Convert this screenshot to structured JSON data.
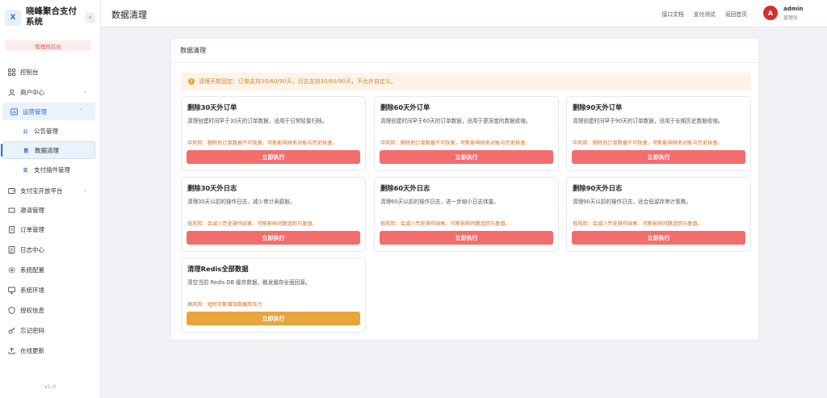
{
  "brand": {
    "logo": "X",
    "name": "晓峰聚合支付系统",
    "collapse_icon": "‹"
  },
  "admin_tag": "管理员后台",
  "menu": {
    "dashboard": "控制台",
    "merchant": "商户中心",
    "operations": "运营管理",
    "notice_mgmt": "公告管理",
    "data_clean": "数据清理",
    "plugin_mgmt": "支付插件管理",
    "alipay_open": "支付宝开放平台",
    "invite": "邀请管理",
    "orders": "订单管理",
    "logs": "日志中心",
    "config": "系统配置",
    "env": "系统环境",
    "license": "授权信息",
    "forgot_pwd": "忘记密码",
    "online_update": "在线更新",
    "sub_icons": {
      "notice": "公",
      "clean": "数",
      "plugin": "支"
    }
  },
  "version": "v1.0",
  "header": {
    "title": "数据清理",
    "links": [
      "接口文档",
      "支付测试",
      "返回首页"
    ],
    "avatar": "A",
    "user_name": "admin",
    "user_role": "管理员"
  },
  "panel": {
    "title": "数据清理",
    "notice": "清理天数固定：订单支持30/60/90天，日志支持30/60/90天，不允许自定义。",
    "notice_icon": "!"
  },
  "cards": [
    {
      "title": "删除30天外订单",
      "desc": "清理创建时间早于30天的订单数据，适用于日常轻量归档。",
      "risk": "中风险：删除后订单数据不可恢复，可能影响财务对账与历史核查。",
      "button": "立即执行"
    },
    {
      "title": "删除60天外订单",
      "desc": "清理创建时间早于60天的订单数据，适用于更深度的数据收缩。",
      "risk": "中风险：删除后订单数据不可恢复，可能影响财务对账与历史核查。",
      "button": "立即执行"
    },
    {
      "title": "删除90天外订单",
      "desc": "清理创建时间早于90天的订单数据，适用于长期历史数据收缩。",
      "risk": "中风险：删除后订单数据不可恢复，可能影响财务对账与历史核查。",
      "button": "立即执行"
    },
    {
      "title": "删除30天外日志",
      "desc": "清理30天以前的操作日志，减少审计表膨胀。",
      "risk": "低风险：会减少历史操作线索，可能影响问题追踪与复盘。",
      "button": "立即执行"
    },
    {
      "title": "删除60天外日志",
      "desc": "清理60天以前的操作日志，进一步缩小日志体量。",
      "risk": "低风险：会减少历史操作线索，可能影响问题追踪与复盘。",
      "button": "立即执行"
    },
    {
      "title": "删除90天外日志",
      "desc": "清理90天以前的操作日志，适合低留存审计策略。",
      "risk": "低风险：会减少历史操作线索，可能影响问题追踪与复盘。",
      "button": "立即执行"
    },
    {
      "title": "清理Redis全部数据",
      "desc": "清空当前 Redis DB 缓存数据，触发缓存全面回源。",
      "risk": "高风险：短时可能增加数据库压力",
      "button": "立即执行"
    }
  ],
  "colors": {
    "accent": "#2f6fd6",
    "danger_button": "#f36d6d",
    "warning_button": "#e9a43c",
    "risk_text": "#d4691c"
  }
}
